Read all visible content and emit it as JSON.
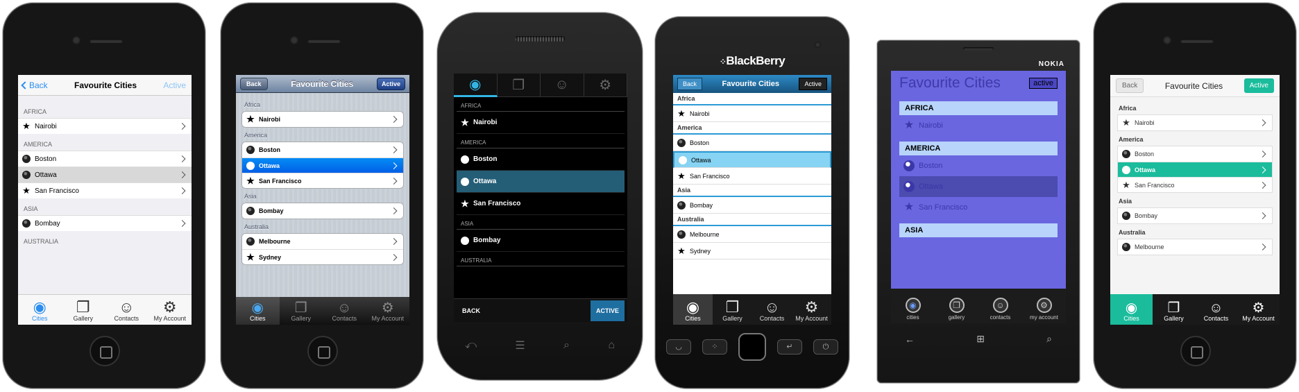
{
  "phone1": {
    "nav": {
      "back": "Back",
      "title": "Favourite Cities",
      "right": "Active"
    },
    "sections": [
      {
        "header": "AFRICA",
        "items": [
          {
            "label": "Nairobi",
            "icon": "star-icon",
            "selected": false
          }
        ]
      },
      {
        "header": "AMERICA",
        "items": [
          {
            "label": "Boston",
            "icon": "globe-icon",
            "selected": false
          },
          {
            "label": "Ottawa",
            "icon": "globe-icon",
            "selected": true
          },
          {
            "label": "San Francisco",
            "icon": "star-icon",
            "selected": false
          }
        ]
      },
      {
        "header": "ASIA",
        "items": [
          {
            "label": "Bombay",
            "icon": "globe-icon",
            "selected": false
          }
        ]
      },
      {
        "header": "AUSTRALIA",
        "items": []
      }
    ],
    "tabs": [
      "Cities",
      "Gallery",
      "Contacts",
      "My Account"
    ],
    "active_tab": 0,
    "accent": "#2a8ef0"
  },
  "phone2": {
    "nav": {
      "back": "Back",
      "title": "Favourite Cities",
      "right": "Active"
    },
    "sections": [
      {
        "header": "Africa",
        "items": [
          {
            "label": "Nairobi",
            "icon": "star-icon",
            "selected": false
          }
        ]
      },
      {
        "header": "America",
        "items": [
          {
            "label": "Boston",
            "icon": "globe-icon",
            "selected": false
          },
          {
            "label": "Ottawa",
            "icon": "globe-icon",
            "selected": true
          },
          {
            "label": "San Francisco",
            "icon": "star-icon",
            "selected": false
          }
        ]
      },
      {
        "header": "Asia",
        "items": [
          {
            "label": "Bombay",
            "icon": "globe-icon",
            "selected": false
          }
        ]
      },
      {
        "header": "Australia",
        "items": [
          {
            "label": "Melbourne",
            "icon": "globe-icon",
            "selected": false
          },
          {
            "label": "Sydney",
            "icon": "star-icon",
            "selected": false
          }
        ]
      }
    ],
    "tabs": [
      "Cities",
      "Gallery",
      "Contacts",
      "My Account"
    ],
    "active_tab": 0,
    "accent": "#1a6ee8"
  },
  "phone3": {
    "tab_icons": [
      "globe-icon",
      "gallery-icon",
      "contacts-icon",
      "gear-icon"
    ],
    "sections": [
      {
        "header": "AFRICA",
        "items": [
          {
            "label": "Nairobi",
            "icon": "star-icon",
            "selected": false
          }
        ]
      },
      {
        "header": "AMERICA",
        "items": [
          {
            "label": "Boston",
            "icon": "globe-icon",
            "selected": false
          },
          {
            "label": "Ottawa",
            "icon": "globe-icon",
            "selected": true
          },
          {
            "label": "San Francisco",
            "icon": "star-icon",
            "selected": false
          }
        ]
      },
      {
        "header": "ASIA",
        "items": [
          {
            "label": "Bombay",
            "icon": "globe-icon",
            "selected": false
          }
        ]
      },
      {
        "header": "AUSTRALIA",
        "items": []
      }
    ],
    "bottom": {
      "back": "BACK",
      "active": "ACTIVE"
    },
    "accent": "#33b5e5"
  },
  "phone4": {
    "brand": "BlackBerry",
    "nav": {
      "back": "Back",
      "title": "Favourite Cities",
      "right": "Active"
    },
    "sections": [
      {
        "header": "Africa",
        "items": [
          {
            "label": "Nairobi",
            "icon": "star-icon",
            "selected": false
          }
        ]
      },
      {
        "header": "America",
        "items": [
          {
            "label": "Boston",
            "icon": "globe-icon",
            "selected": false
          },
          {
            "label": "Ottawa",
            "icon": "globe-icon",
            "selected": true
          },
          {
            "label": "San Francisco",
            "icon": "star-icon",
            "selected": false
          }
        ]
      },
      {
        "header": "Asia",
        "items": [
          {
            "label": "Bombay",
            "icon": "globe-icon",
            "selected": false
          }
        ]
      },
      {
        "header": "Australia",
        "items": [
          {
            "label": "Melbourne",
            "icon": "globe-icon",
            "selected": false
          },
          {
            "label": "Sydney",
            "icon": "star-icon",
            "selected": false
          }
        ]
      }
    ],
    "tabs": [
      "Cities",
      "Gallery",
      "Contacts",
      "My Account"
    ],
    "active_tab": 0,
    "accent": "#2a9ad6"
  },
  "phone5": {
    "brand": "NOKIA",
    "title": "Favourite Cities",
    "right": "active",
    "sections": [
      {
        "header": "AFRICA",
        "items": [
          {
            "label": "Nairobi",
            "icon": "star-icon",
            "selected": false
          }
        ]
      },
      {
        "header": "AMERICA",
        "items": [
          {
            "label": "Boston",
            "icon": "globe-icon",
            "selected": false
          },
          {
            "label": "Ottawa",
            "icon": "globe-icon",
            "selected": true
          },
          {
            "label": "San Francisco",
            "icon": "star-icon",
            "selected": false
          }
        ]
      },
      {
        "header": "ASIA",
        "items": []
      }
    ],
    "tabs": [
      "cities",
      "gallery",
      "contacts",
      "my account"
    ],
    "accent": "#6a66e0"
  },
  "phone6": {
    "nav": {
      "back": "Back",
      "title": "Favourite Cities",
      "right": "Active"
    },
    "sections": [
      {
        "header": "Africa",
        "items": [
          {
            "label": "Nairobi",
            "icon": "star-icon",
            "selected": false
          }
        ]
      },
      {
        "header": "America",
        "items": [
          {
            "label": "Boston",
            "icon": "globe-icon",
            "selected": false
          },
          {
            "label": "Ottawa",
            "icon": "globe-icon",
            "selected": true
          },
          {
            "label": "San Francisco",
            "icon": "star-icon",
            "selected": false
          }
        ]
      },
      {
        "header": "Asia",
        "items": [
          {
            "label": "Bombay",
            "icon": "globe-icon",
            "selected": false
          }
        ]
      },
      {
        "header": "Australia",
        "items": [
          {
            "label": "Melbourne",
            "icon": "globe-icon",
            "selected": false
          }
        ]
      }
    ],
    "tabs": [
      "Cities",
      "Gallery",
      "Contacts",
      "My Account"
    ],
    "active_tab": 0,
    "accent": "#1abc9c"
  }
}
